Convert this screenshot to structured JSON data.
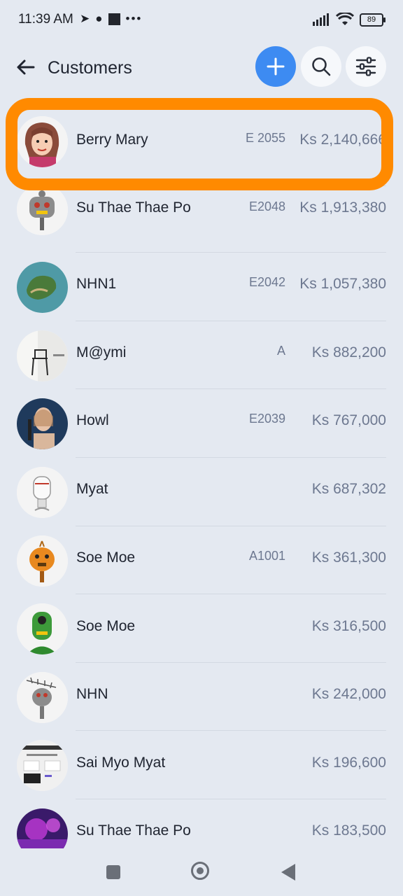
{
  "status_bar": {
    "time": "11:39 AM",
    "battery": "89",
    "dots": "•••"
  },
  "header": {
    "title": "Customers"
  },
  "customers": [
    {
      "name": "Berry Mary",
      "code": "E 2055",
      "amount": "Ks 2,140,666",
      "avatar": "woman-cartoon"
    },
    {
      "name": "Su Thae Thae Po",
      "code": "E2048",
      "amount": "Ks 1,913,380",
      "avatar": "robot-gray"
    },
    {
      "name": "NHN1",
      "code": "E2042",
      "amount": "Ks 1,057,380",
      "avatar": "island-photo"
    },
    {
      "name": "M@ymi",
      "code": "A",
      "amount": "Ks 882,200",
      "avatar": "chair-photo"
    },
    {
      "name": "Howl",
      "code": "E2039",
      "amount": "Ks 767,000",
      "avatar": "woman-photo"
    },
    {
      "name": "Myat",
      "code": "",
      "amount": "Ks 687,302",
      "avatar": "robot-white"
    },
    {
      "name": "Soe Moe",
      "code": "A1001",
      "amount": "Ks 361,300",
      "avatar": "robot-orange"
    },
    {
      "name": "Soe Moe",
      "code": "",
      "amount": "Ks 316,500",
      "avatar": "robot-green"
    },
    {
      "name": "NHN",
      "code": "",
      "amount": "Ks 242,000",
      "avatar": "robot-antenna"
    },
    {
      "name": "Sai Myo Myat",
      "code": "",
      "amount": "Ks 196,600",
      "avatar": "website-screenshot"
    },
    {
      "name": "Su Thae Thae Po",
      "code": "",
      "amount": "Ks 183,500",
      "avatar": "purple-photo"
    }
  ],
  "colors": {
    "accent": "#3d8bf2",
    "highlight": "#ff8a00",
    "background": "#e4e9f1"
  }
}
